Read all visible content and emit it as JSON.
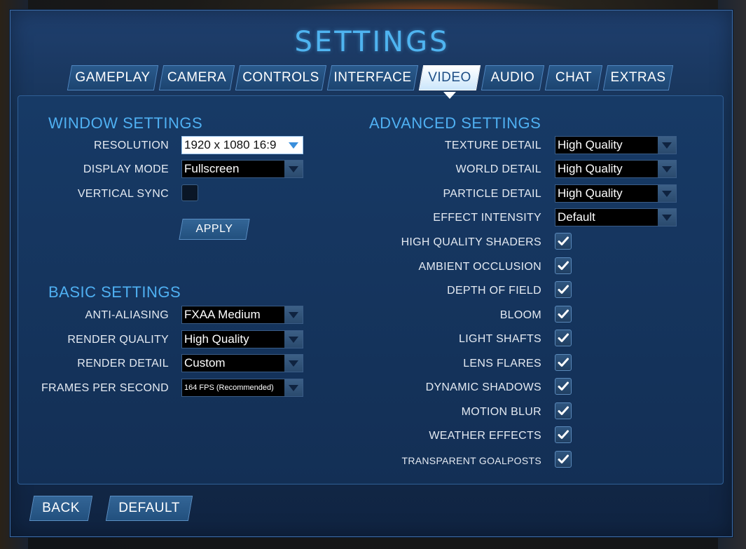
{
  "title": "SETTINGS",
  "tabs": [
    "GAMEPLAY",
    "CAMERA",
    "CONTROLS",
    "INTERFACE",
    "VIDEO",
    "AUDIO",
    "CHAT",
    "EXTRAS"
  ],
  "active_tab": "VIDEO",
  "window_settings": {
    "title": "WINDOW SETTINGS",
    "resolution_label": "RESOLUTION",
    "resolution_value": "1920 x 1080 16:9",
    "display_mode_label": "DISPLAY MODE",
    "display_mode_value": "Fullscreen",
    "vsync_label": "VERTICAL SYNC",
    "vsync_checked": false,
    "apply_label": "APPLY"
  },
  "basic_settings": {
    "title": "BASIC SETTINGS",
    "anti_aliasing_label": "ANTI-ALIASING",
    "anti_aliasing_value": "FXAA Medium",
    "render_quality_label": "RENDER QUALITY",
    "render_quality_value": "High Quality",
    "render_detail_label": "RENDER DETAIL",
    "render_detail_value": "Custom",
    "fps_label": "FRAMES PER SECOND",
    "fps_value": "164  FPS (Recommended)"
  },
  "advanced_settings": {
    "title": "ADVANCED SETTINGS",
    "texture_detail_label": "TEXTURE DETAIL",
    "texture_detail_value": "High Quality",
    "world_detail_label": "WORLD DETAIL",
    "world_detail_value": "High Quality",
    "particle_detail_label": "PARTICLE DETAIL",
    "particle_detail_value": "High Quality",
    "effect_intensity_label": "EFFECT INTENSITY",
    "effect_intensity_value": "Default",
    "checkboxes": [
      {
        "label": "HIGH QUALITY SHADERS",
        "checked": true
      },
      {
        "label": "AMBIENT OCCLUSION",
        "checked": true
      },
      {
        "label": "DEPTH OF FIELD",
        "checked": true
      },
      {
        "label": "BLOOM",
        "checked": true
      },
      {
        "label": "LIGHT SHAFTS",
        "checked": true
      },
      {
        "label": "LENS FLARES",
        "checked": true
      },
      {
        "label": "DYNAMIC SHADOWS",
        "checked": true
      },
      {
        "label": "MOTION BLUR",
        "checked": true
      },
      {
        "label": "WEATHER EFFECTS",
        "checked": true
      },
      {
        "label": "TRANSPARENT GOALPOSTS",
        "checked": true
      }
    ]
  },
  "footer": {
    "back_label": "BACK",
    "default_label": "DEFAULT"
  },
  "icons": {
    "dropdown": "triangle-down-icon",
    "checkmark": "checkmark-icon"
  },
  "colors": {
    "accent": "#4fb0f2",
    "panel": "#173459",
    "active_tab": "#ffffff"
  }
}
